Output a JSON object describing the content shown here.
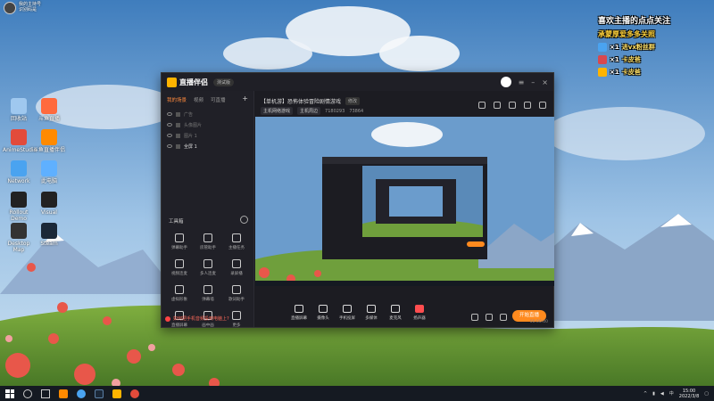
{
  "desktop": {
    "profile": {
      "line1": "我的主持号",
      "line2": "识别码是"
    },
    "icons": [
      {
        "label": "回收站",
        "color": "#9fc8ef"
      },
      {
        "label": "斗鱼直播",
        "color": "#ff6a3d"
      },
      {
        "label": "AnimeStudio",
        "color": "#e24b3b"
      },
      {
        "label": "斗鱼直播伴侣",
        "color": "#ff8a00"
      },
      {
        "label": "Network",
        "color": "#4aa3f0"
      },
      {
        "label": "此电脑",
        "color": "#5fb0ff"
      },
      {
        "label": "Rollout Demo",
        "color": "#222"
      },
      {
        "label": "Visual",
        "color": "#222"
      },
      {
        "label": "Desktop Map",
        "color": "#333"
      },
      {
        "label": "Steam",
        "color": "#1b2838"
      }
    ]
  },
  "overlay": {
    "title": "喜欢主播的点点关注",
    "subtitle": "承蒙厚爱多多关照",
    "rows": [
      {
        "count": "×1",
        "text": "进vx粉丝群",
        "color": "#4aa3f0"
      },
      {
        "count": "×1",
        "text": "卡皮爸",
        "color": "#d8484f"
      },
      {
        "count": "×1",
        "text": "卡皮爸",
        "color": "#ffb400"
      }
    ]
  },
  "app": {
    "logo": "直播伴侣",
    "beta": "测试版",
    "tabs": [
      "我的场景",
      "视频",
      "可直播"
    ],
    "scenes": [
      {
        "label": "广告",
        "on": false
      },
      {
        "label": "头像图片",
        "on": false
      },
      {
        "label": "图片 1",
        "on": false
      },
      {
        "label": "全屏 1",
        "on": true
      }
    ],
    "room_title": "【单机游】恐怖体验冒险剧情游戏",
    "edit_label": "修改",
    "tags": [
      "主机网络游戏",
      "主机周边"
    ],
    "viewer_count": "7180293",
    "heat": "73864",
    "toolbox_title": "工具箱",
    "tools": [
      "弹幕助手",
      "房管助手",
      "主播任务",
      "视频连麦",
      "多人连麦",
      "录屏播",
      "虚拟形象",
      "弹幕墙",
      "歌词助手",
      "直播屏幕",
      "画中画",
      "更多"
    ],
    "hint": "如何把手机音频投到电脑上?",
    "controls": [
      "直播屏幕",
      "摄像头",
      "手机投屏",
      "多媒体",
      "麦克风",
      "扬声器"
    ],
    "go_live": "开始直播",
    "status": "00:00:00"
  },
  "taskbar": {
    "time": "15:00",
    "date": "2022/3/8",
    "lang": "中"
  }
}
